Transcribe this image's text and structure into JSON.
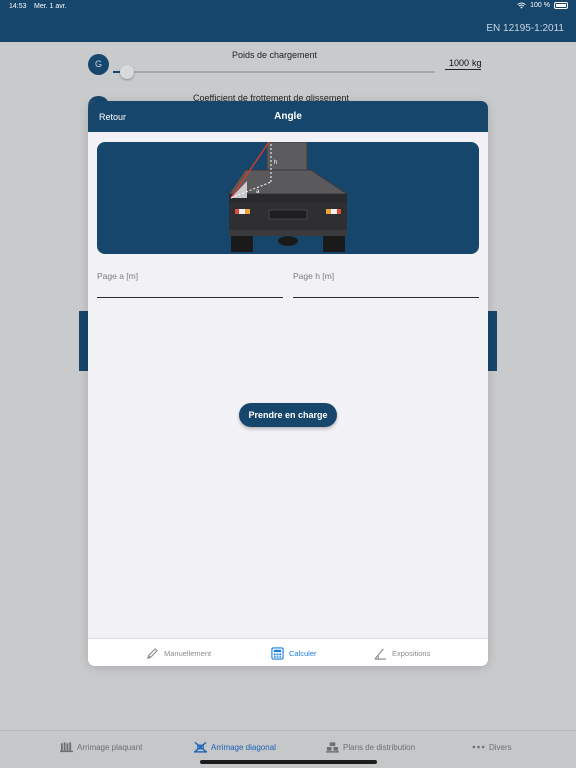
{
  "status_bar": {
    "time": "14:53",
    "date": "Mer. 1 avr.",
    "battery": "100 %"
  },
  "header": {
    "standard": "EN 12195-1:2011"
  },
  "background_form": {
    "g_badge": "G",
    "weight_label": "Poids de chargement",
    "weight_value": "1000",
    "weight_unit": "kg",
    "friction_label": "Coefficient de frottement de glissement",
    "weight_slider_fraction": 0.02
  },
  "modal": {
    "back_label": "Retour",
    "title": "Angle",
    "illustration": {
      "label_h": "h",
      "label_a": "a"
    },
    "field_a_label": "Page a [m]",
    "field_a_value": "",
    "field_h_label": "Page h [m]",
    "field_h_value": "",
    "submit_label": "Prendre en charge",
    "tabs": [
      {
        "label": "Manuellement",
        "icon": "pencil-icon",
        "active": false
      },
      {
        "label": "Calculer",
        "icon": "calculator-icon",
        "active": true
      },
      {
        "label": "Expositions",
        "icon": "angle-icon",
        "active": false
      }
    ]
  },
  "tabbar": {
    "items": [
      {
        "label": "Arrimage plaquant",
        "icon": "tiedown-icon",
        "active": false
      },
      {
        "label": "Arrimage diagonal",
        "icon": "diagonal-lashing-icon",
        "active": true
      },
      {
        "label": "Plans de distribution",
        "icon": "pallets-icon",
        "active": false
      },
      {
        "label": "Divers",
        "icon": "more-icon",
        "active": false
      }
    ]
  },
  "colors": {
    "primary": "#17466c",
    "accent": "#1b7ce0",
    "background": "#f1f1f6"
  }
}
